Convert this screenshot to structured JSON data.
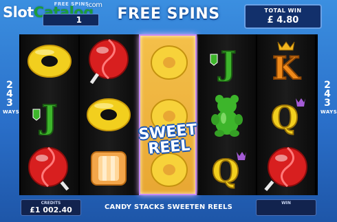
{
  "watermark": {
    "part1": "Slot",
    "part2": "Catalog",
    "suffix": ".com"
  },
  "header": {
    "free_spins_label": "FREE SPINS",
    "free_spins_value": "1",
    "title": "FREE SPINS",
    "total_win_label": "TOTAL WIN",
    "total_win_value": "£ 4.80"
  },
  "ways": {
    "number": [
      "2",
      "4",
      "3"
    ],
    "label": "WAYS"
  },
  "reels": [
    [
      "yellow-candy-ring",
      "jack-card",
      "red-lollipop"
    ],
    [
      "red-lollipop",
      "yellow-candy-ring",
      "orange-toffee"
    ],
    [
      "sweet-reel-wild",
      "sweet-reel-wild",
      "sweet-reel-wild"
    ],
    [
      "jack-card",
      "green-gummy-bear",
      "queen-card"
    ],
    [
      "king-card",
      "queen-card",
      "red-lollipop"
    ]
  ],
  "card_letters": {
    "jack": "J",
    "queen": "Q",
    "king": "K"
  },
  "sweet_reel": {
    "line1": "SWEET",
    "line2": "REEL"
  },
  "footer": {
    "credits_label": "CREDITS",
    "credits_value": "£1 002.40",
    "message": "CANDY STACKS SWEETEN REELS",
    "win_label": "WIN",
    "win_value": ""
  },
  "colors": {
    "background": "#2a6fc9",
    "panel": "#12306b",
    "candy_yellow": "#f2cf1e",
    "lollipop_red": "#d81f1f",
    "gummy_green": "#3db52b",
    "wild_reel_gold": "#e8a733"
  }
}
